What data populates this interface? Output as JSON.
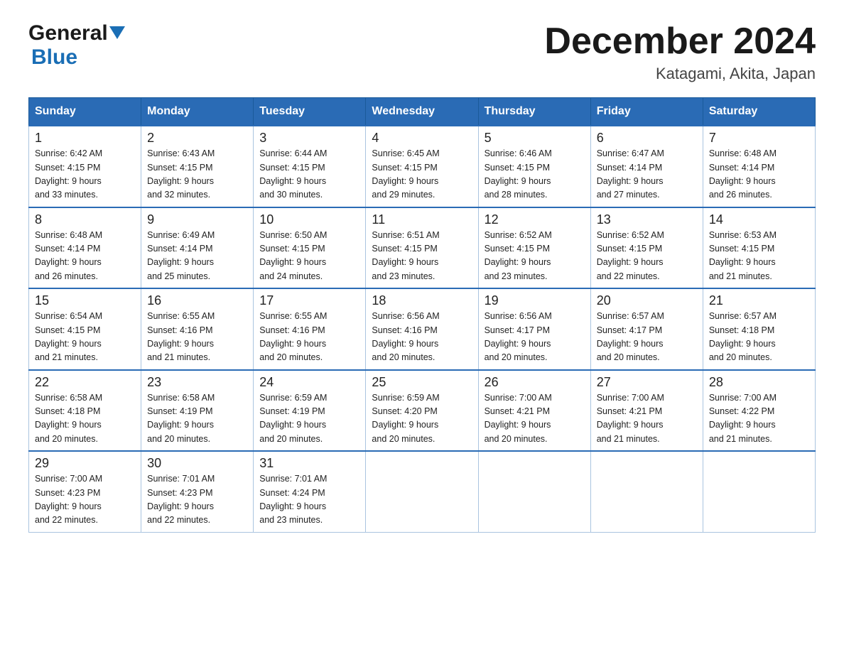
{
  "header": {
    "logo_general": "General",
    "logo_blue": "Blue",
    "month_title": "December 2024",
    "location": "Katagami, Akita, Japan"
  },
  "weekdays": [
    "Sunday",
    "Monday",
    "Tuesday",
    "Wednesday",
    "Thursday",
    "Friday",
    "Saturday"
  ],
  "weeks": [
    [
      {
        "day": "1",
        "sunrise": "6:42 AM",
        "sunset": "4:15 PM",
        "daylight": "9 hours and 33 minutes."
      },
      {
        "day": "2",
        "sunrise": "6:43 AM",
        "sunset": "4:15 PM",
        "daylight": "9 hours and 32 minutes."
      },
      {
        "day": "3",
        "sunrise": "6:44 AM",
        "sunset": "4:15 PM",
        "daylight": "9 hours and 30 minutes."
      },
      {
        "day": "4",
        "sunrise": "6:45 AM",
        "sunset": "4:15 PM",
        "daylight": "9 hours and 29 minutes."
      },
      {
        "day": "5",
        "sunrise": "6:46 AM",
        "sunset": "4:15 PM",
        "daylight": "9 hours and 28 minutes."
      },
      {
        "day": "6",
        "sunrise": "6:47 AM",
        "sunset": "4:14 PM",
        "daylight": "9 hours and 27 minutes."
      },
      {
        "day": "7",
        "sunrise": "6:48 AM",
        "sunset": "4:14 PM",
        "daylight": "9 hours and 26 minutes."
      }
    ],
    [
      {
        "day": "8",
        "sunrise": "6:48 AM",
        "sunset": "4:14 PM",
        "daylight": "9 hours and 26 minutes."
      },
      {
        "day": "9",
        "sunrise": "6:49 AM",
        "sunset": "4:14 PM",
        "daylight": "9 hours and 25 minutes."
      },
      {
        "day": "10",
        "sunrise": "6:50 AM",
        "sunset": "4:15 PM",
        "daylight": "9 hours and 24 minutes."
      },
      {
        "day": "11",
        "sunrise": "6:51 AM",
        "sunset": "4:15 PM",
        "daylight": "9 hours and 23 minutes."
      },
      {
        "day": "12",
        "sunrise": "6:52 AM",
        "sunset": "4:15 PM",
        "daylight": "9 hours and 23 minutes."
      },
      {
        "day": "13",
        "sunrise": "6:52 AM",
        "sunset": "4:15 PM",
        "daylight": "9 hours and 22 minutes."
      },
      {
        "day": "14",
        "sunrise": "6:53 AM",
        "sunset": "4:15 PM",
        "daylight": "9 hours and 21 minutes."
      }
    ],
    [
      {
        "day": "15",
        "sunrise": "6:54 AM",
        "sunset": "4:15 PM",
        "daylight": "9 hours and 21 minutes."
      },
      {
        "day": "16",
        "sunrise": "6:55 AM",
        "sunset": "4:16 PM",
        "daylight": "9 hours and 21 minutes."
      },
      {
        "day": "17",
        "sunrise": "6:55 AM",
        "sunset": "4:16 PM",
        "daylight": "9 hours and 20 minutes."
      },
      {
        "day": "18",
        "sunrise": "6:56 AM",
        "sunset": "4:16 PM",
        "daylight": "9 hours and 20 minutes."
      },
      {
        "day": "19",
        "sunrise": "6:56 AM",
        "sunset": "4:17 PM",
        "daylight": "9 hours and 20 minutes."
      },
      {
        "day": "20",
        "sunrise": "6:57 AM",
        "sunset": "4:17 PM",
        "daylight": "9 hours and 20 minutes."
      },
      {
        "day": "21",
        "sunrise": "6:57 AM",
        "sunset": "4:18 PM",
        "daylight": "9 hours and 20 minutes."
      }
    ],
    [
      {
        "day": "22",
        "sunrise": "6:58 AM",
        "sunset": "4:18 PM",
        "daylight": "9 hours and 20 minutes."
      },
      {
        "day": "23",
        "sunrise": "6:58 AM",
        "sunset": "4:19 PM",
        "daylight": "9 hours and 20 minutes."
      },
      {
        "day": "24",
        "sunrise": "6:59 AM",
        "sunset": "4:19 PM",
        "daylight": "9 hours and 20 minutes."
      },
      {
        "day": "25",
        "sunrise": "6:59 AM",
        "sunset": "4:20 PM",
        "daylight": "9 hours and 20 minutes."
      },
      {
        "day": "26",
        "sunrise": "7:00 AM",
        "sunset": "4:21 PM",
        "daylight": "9 hours and 20 minutes."
      },
      {
        "day": "27",
        "sunrise": "7:00 AM",
        "sunset": "4:21 PM",
        "daylight": "9 hours and 21 minutes."
      },
      {
        "day": "28",
        "sunrise": "7:00 AM",
        "sunset": "4:22 PM",
        "daylight": "9 hours and 21 minutes."
      }
    ],
    [
      {
        "day": "29",
        "sunrise": "7:00 AM",
        "sunset": "4:23 PM",
        "daylight": "9 hours and 22 minutes."
      },
      {
        "day": "30",
        "sunrise": "7:01 AM",
        "sunset": "4:23 PM",
        "daylight": "9 hours and 22 minutes."
      },
      {
        "day": "31",
        "sunrise": "7:01 AM",
        "sunset": "4:24 PM",
        "daylight": "9 hours and 23 minutes."
      },
      null,
      null,
      null,
      null
    ]
  ],
  "labels": {
    "sunrise": "Sunrise:",
    "sunset": "Sunset:",
    "daylight": "Daylight:"
  }
}
